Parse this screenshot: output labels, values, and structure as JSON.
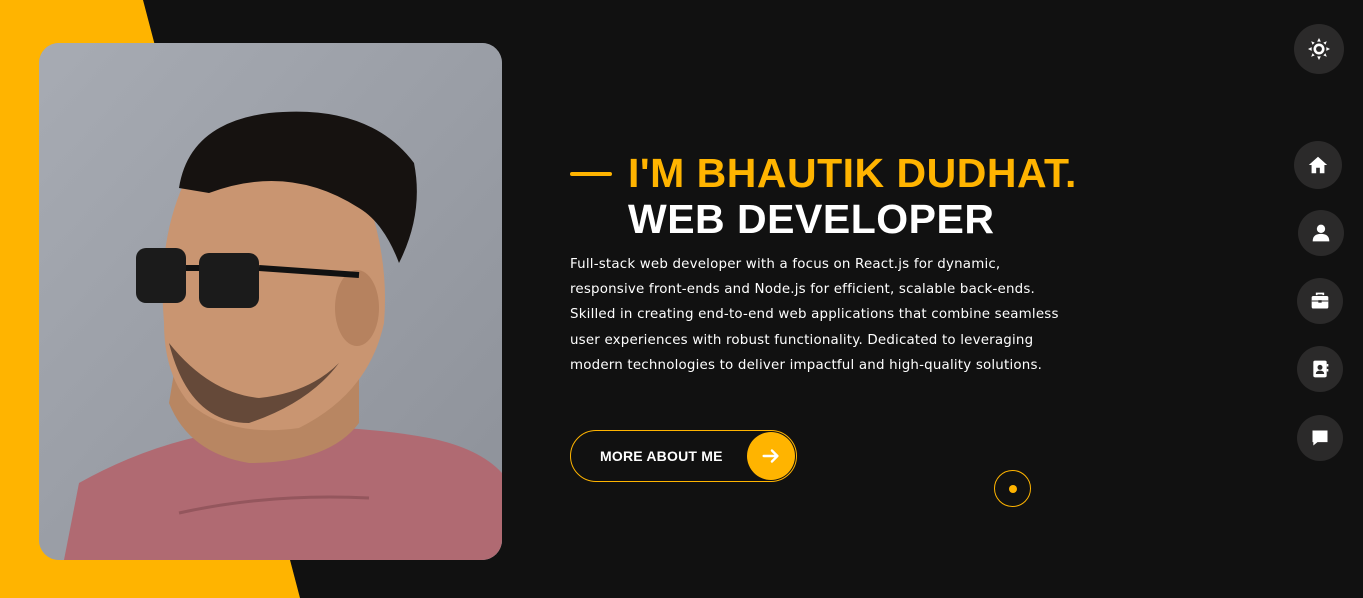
{
  "colors": {
    "accent": "#ffb400",
    "background": "#111111",
    "nav_button_bg": "#2b2a2a",
    "text": "#ffffff"
  },
  "profile_photo": {
    "subject": "man with dark quiff hairstyle and sunglasses, pink t-shirt"
  },
  "hero": {
    "name_heading": "I'M BHAUTIK DUDHAT.",
    "role_heading": "WEB DEVELOPER",
    "bio": "Full-stack web developer with a focus on React.js for dynamic, responsive front-ends and Node.js for efficient, scalable back-ends. Skilled in creating end-to-end web applications that combine seamless user experiences with robust functionality. Dedicated to leveraging modern technologies to deliver impactful and high-quality solutions.",
    "cta_label": "MORE ABOUT ME",
    "cta_icon": "arrow-right-icon"
  },
  "theme_toggle": {
    "icon": "sun-icon"
  },
  "side_nav": [
    {
      "id": "home",
      "icon": "home-icon"
    },
    {
      "id": "about",
      "icon": "user-icon"
    },
    {
      "id": "portfolio",
      "icon": "briefcase-icon"
    },
    {
      "id": "contact",
      "icon": "contact-book-icon"
    },
    {
      "id": "blog",
      "icon": "chat-icon"
    }
  ]
}
